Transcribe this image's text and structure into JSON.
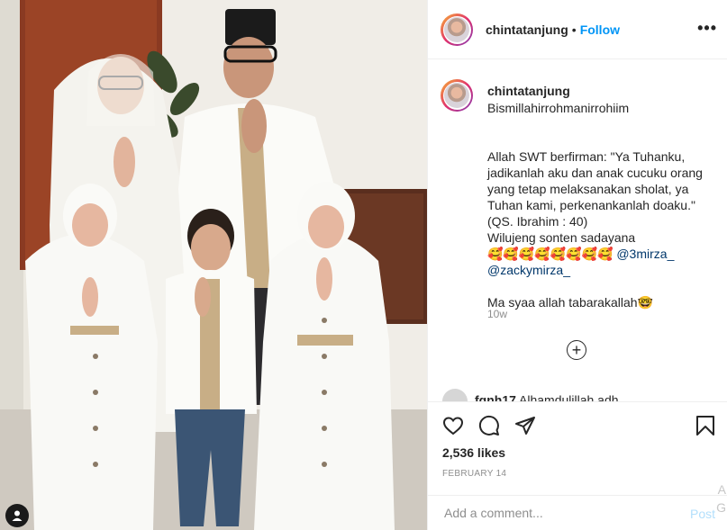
{
  "post": {
    "username": "chintatanjung",
    "follow_label": "Follow",
    "separator": "•",
    "more_icon": "more-horizontal-icon"
  },
  "caption": {
    "username": "chintatanjung",
    "lines": [
      "Bismillahirrohmanirrohiim",
      "",
      "Allah SWT berfirman: \"Ya Tuhanku, jadikanlah aku dan anak cucuku orang yang tetap melaksanakan sholat, ya Tuhan kami, perkenankanlah doaku.\" (QS. Ibrahim : 40)",
      "Wilujeng sonten sadayana"
    ],
    "emojis": "🥰🥰🥰🥰🥰🥰🥰🥰",
    "mention_1": "@3mirza_",
    "mention_2": "@zackymirza_",
    "closing": "Ma syaa allah tabarakallah🤓",
    "time": "10w"
  },
  "comment_peek": {
    "username": "fqnh17",
    "text": "Alhamdulillah adh"
  },
  "actions": {
    "like_icon": "heart-icon",
    "comment_icon": "comment-icon",
    "share_icon": "paper-plane-icon",
    "save_icon": "bookmark-icon",
    "likes": "2,536 likes",
    "date": "FEBRUARY 14"
  },
  "add_comment": {
    "placeholder": "Add a comment...",
    "post_label": "Post"
  },
  "edge_text": {
    "line1": "A",
    "line2": "G"
  },
  "photo": {
    "user_tag_icon": "user-icon"
  }
}
